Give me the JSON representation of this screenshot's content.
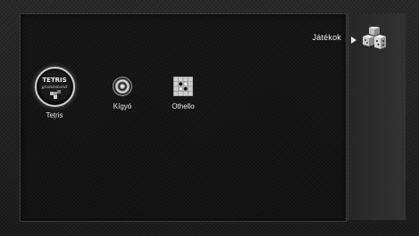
{
  "header": {
    "section_title": "Játékok",
    "section_icon": "games-cube-icon"
  },
  "games": [
    {
      "label": "Tetris",
      "icon": "tetris-icon",
      "selected": true
    },
    {
      "label": "Kígyó",
      "icon": "snake-spiral-icon",
      "selected": false
    },
    {
      "label": "Othello",
      "icon": "othello-board-icon",
      "selected": false
    }
  ],
  "colors": {
    "background": "#202020",
    "panel": "#161616",
    "text": "#e8e8e8",
    "selection_ring": "#d0d0d0"
  }
}
